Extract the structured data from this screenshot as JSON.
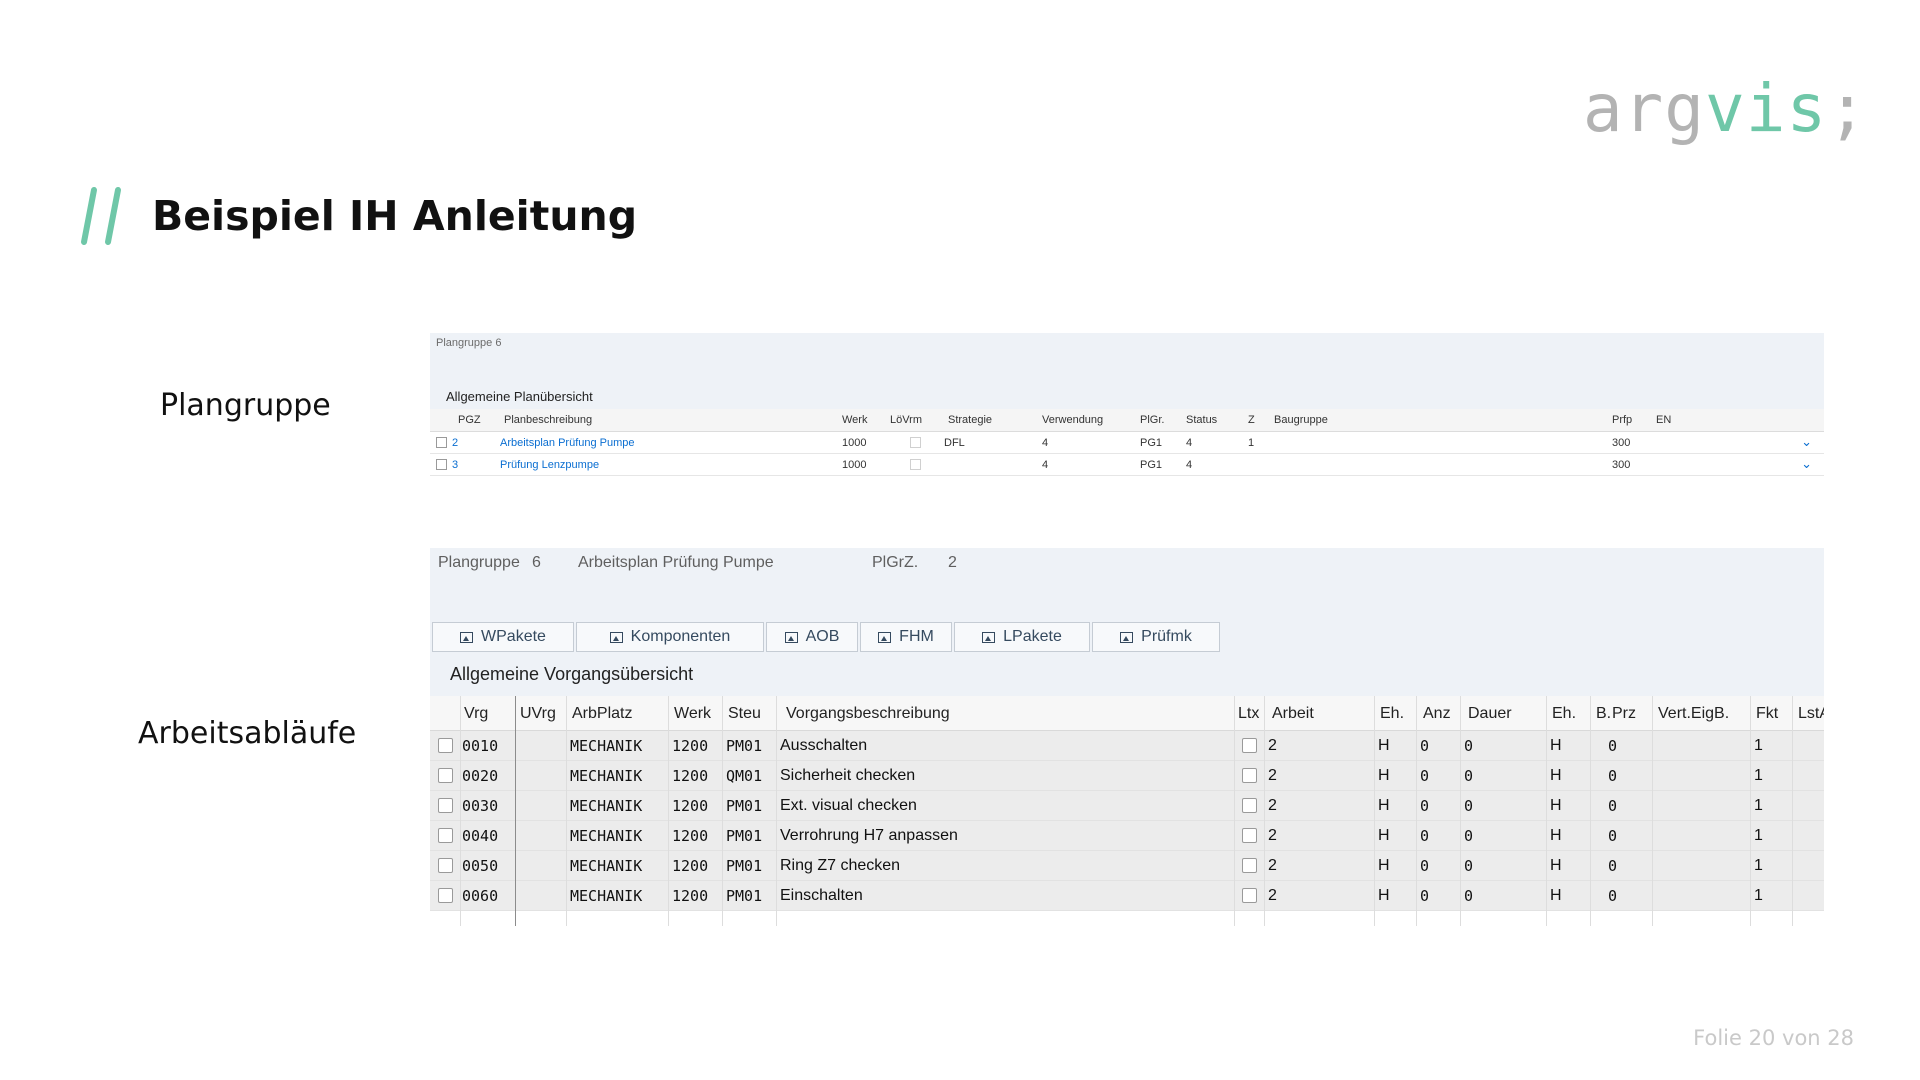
{
  "logo": {
    "part1": "arg",
    "part2": "vis",
    "part3": ";"
  },
  "slide": {
    "title": "Beispiel IH Anleitung",
    "label_plangruppe": "Plangruppe",
    "label_arbeitsablaeufe": "Arbeitsabläufe",
    "footer": "Folie 20 von 28"
  },
  "colors": {
    "accent": "#6fc7a8",
    "link": "#0a6ed1",
    "panel": "#eef2f7"
  },
  "plangruppe_screen": {
    "header": "Plangruppe  6",
    "section_title": "Allgemeine Planübersicht",
    "columns": [
      "PGZ",
      "Planbeschreibung",
      "Werk",
      "LöVrm",
      "Strategie",
      "Verwendung",
      "PlGr.",
      "Status",
      "Z",
      "Baugruppe",
      "Prfp",
      "EN"
    ],
    "rows": [
      {
        "pgz": "2",
        "beschreibung": "Arbeitsplan Prüfung Pumpe",
        "werk": "1000",
        "strategie": "DFL",
        "verwendung": "4",
        "plgr": "PG1",
        "status": "4",
        "z": "1",
        "baugruppe": "",
        "prfp": "300"
      },
      {
        "pgz": "3",
        "beschreibung": "Prüfung Lenzpumpe",
        "werk": "1000",
        "strategie": "",
        "verwendung": "4",
        "plgr": "PG1",
        "status": "4",
        "z": "",
        "baugruppe": "",
        "prfp": "300"
      }
    ]
  },
  "arbeitsablauf_screen": {
    "plangruppe_label": "Plangruppe",
    "plangruppe_value": "6",
    "plan_name": "Arbeitsplan Prüfung Pumpe",
    "plgrz_label": "PlGrZ.",
    "plgrz_value": "2",
    "tabs": [
      "WPakete",
      "Komponenten",
      "AOB",
      "FHM",
      "LPakete",
      "Prüfmk"
    ],
    "section_title": "Allgemeine Vorgangsübersicht",
    "columns": [
      "Vrg",
      "UVrg",
      "ArbPlatz",
      "Werk",
      "Steu",
      "Vorgangsbeschreibung",
      "Ltx",
      "Arbeit",
      "Eh.",
      "Anz",
      "Dauer",
      "Eh.",
      "B.",
      "Prz",
      "Vert.EigB.",
      "Fkt",
      "LstA"
    ],
    "rows": [
      {
        "vrg": "0010",
        "arbplatz": "MECHANIK",
        "werk": "1200",
        "steu": "PM01",
        "beschreibung": "Ausschalten",
        "arbeit": "2",
        "eh1": "H",
        "anz": "0",
        "dauer": "0",
        "eh2": "H",
        "prz": "0",
        "fkt": "1"
      },
      {
        "vrg": "0020",
        "arbplatz": "MECHANIK",
        "werk": "1200",
        "steu": "QM01",
        "beschreibung": "Sicherheit checken",
        "arbeit": "2",
        "eh1": "H",
        "anz": "0",
        "dauer": "0",
        "eh2": "H",
        "prz": "0",
        "fkt": "1"
      },
      {
        "vrg": "0030",
        "arbplatz": "MECHANIK",
        "werk": "1200",
        "steu": "PM01",
        "beschreibung": "Ext. visual checken",
        "arbeit": "2",
        "eh1": "H",
        "anz": "0",
        "dauer": "0",
        "eh2": "H",
        "prz": "0",
        "fkt": "1"
      },
      {
        "vrg": "0040",
        "arbplatz": "MECHANIK",
        "werk": "1200",
        "steu": "PM01",
        "beschreibung": "Verrohrung H7 anpassen",
        "arbeit": "2",
        "eh1": "H",
        "anz": "0",
        "dauer": "0",
        "eh2": "H",
        "prz": "0",
        "fkt": "1"
      },
      {
        "vrg": "0050",
        "arbplatz": "MECHANIK",
        "werk": "1200",
        "steu": "PM01",
        "beschreibung": "Ring Z7 checken",
        "arbeit": "2",
        "eh1": "H",
        "anz": "0",
        "dauer": "0",
        "eh2": "H",
        "prz": "0",
        "fkt": "1"
      },
      {
        "vrg": "0060",
        "arbplatz": "MECHANIK",
        "werk": "1200",
        "steu": "PM01",
        "beschreibung": "Einschalten",
        "arbeit": "2",
        "eh1": "H",
        "anz": "0",
        "dauer": "0",
        "eh2": "H",
        "prz": "0",
        "fkt": "1"
      }
    ]
  }
}
